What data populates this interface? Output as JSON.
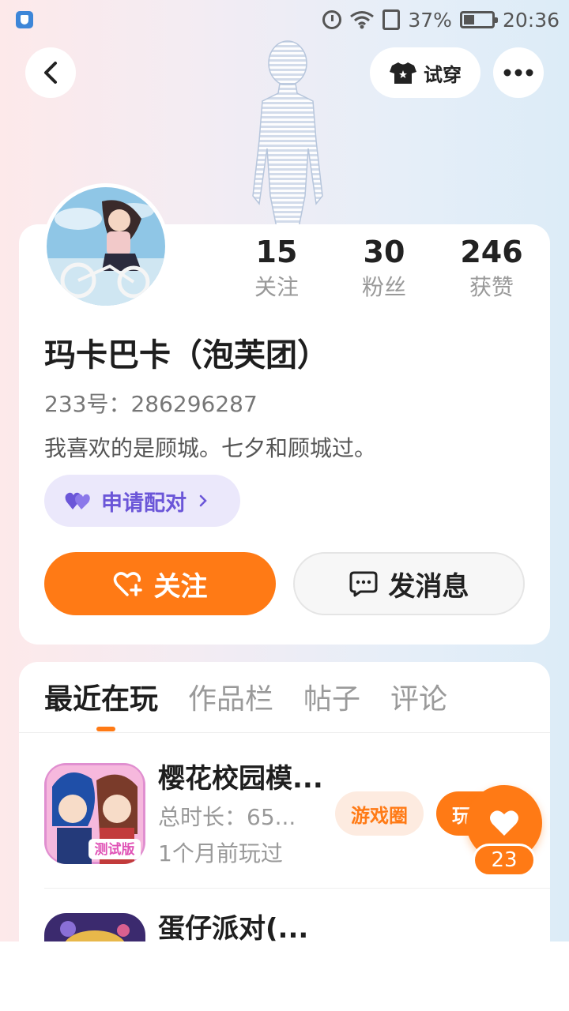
{
  "status_bar": {
    "battery": "37%",
    "battery_level": 0.37,
    "time": "20:36"
  },
  "header": {
    "try_on_label": "试穿"
  },
  "profile": {
    "stats": [
      {
        "value": "15",
        "label": "关注"
      },
      {
        "value": "30",
        "label": "粉丝"
      },
      {
        "value": "246",
        "label": "获赞"
      }
    ],
    "nickname": "玛卡巴卡（泡芙团）",
    "uid": "233号：286296287",
    "bio": "我喜欢的是顾城。七夕和顾城过。",
    "match_label": "申请配对",
    "follow_label": "关注",
    "message_label": "发消息"
  },
  "tabs": [
    {
      "label": "最近在玩",
      "active": true
    },
    {
      "label": "作品栏",
      "active": false
    },
    {
      "label": "帖子",
      "active": false
    },
    {
      "label": "评论",
      "active": false
    }
  ],
  "games": [
    {
      "title": "樱花校园模...",
      "duration": "总时长：65...",
      "last_played": "1个月前玩过",
      "circle_label": "游戏圈",
      "play_label": "玩"
    },
    {
      "title": "蛋仔派对(..."
    }
  ],
  "floating_like": {
    "count": "23"
  },
  "colors": {
    "accent": "#ff7a15",
    "match_purple": "#6b56d8",
    "match_bg": "#ebe8fb"
  }
}
